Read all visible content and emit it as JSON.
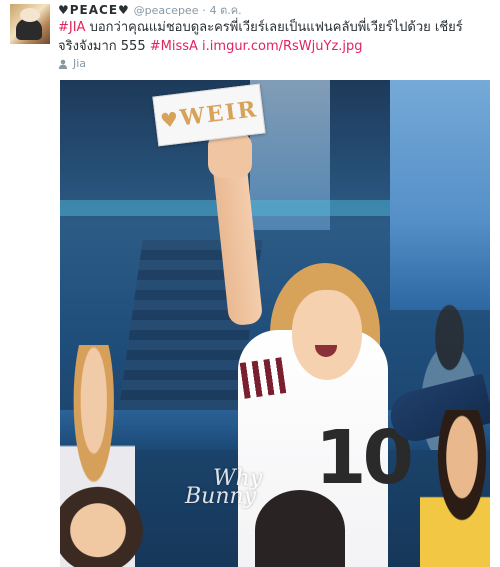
{
  "tweet": {
    "fullname": "♥PEACE♥",
    "username": "@peacepee",
    "dot": "·",
    "time": "4 ต.ค.",
    "text_parts": {
      "hashtag1": "#JIA",
      "body1": " บอกว่าคุณแม่ชอบดูละครพี่เวียร์เลยเป็นแฟนคลับพี่เวียร์ไปด้วย  เชียร์จริงจังมาก 555 ",
      "hashtag2": "#MissA",
      "space": " ",
      "link": "i.imgur.com/RsWjuYz.jpg"
    },
    "retweet_label": "Jia"
  },
  "media": {
    "sign_text": "WEIR",
    "watermark_line1": "Why",
    "watermark_line2": "Bunny",
    "jersey_number": "10"
  },
  "colors": {
    "hashtag": "#e0245e",
    "muted": "#8899a6",
    "text": "#292f33"
  }
}
